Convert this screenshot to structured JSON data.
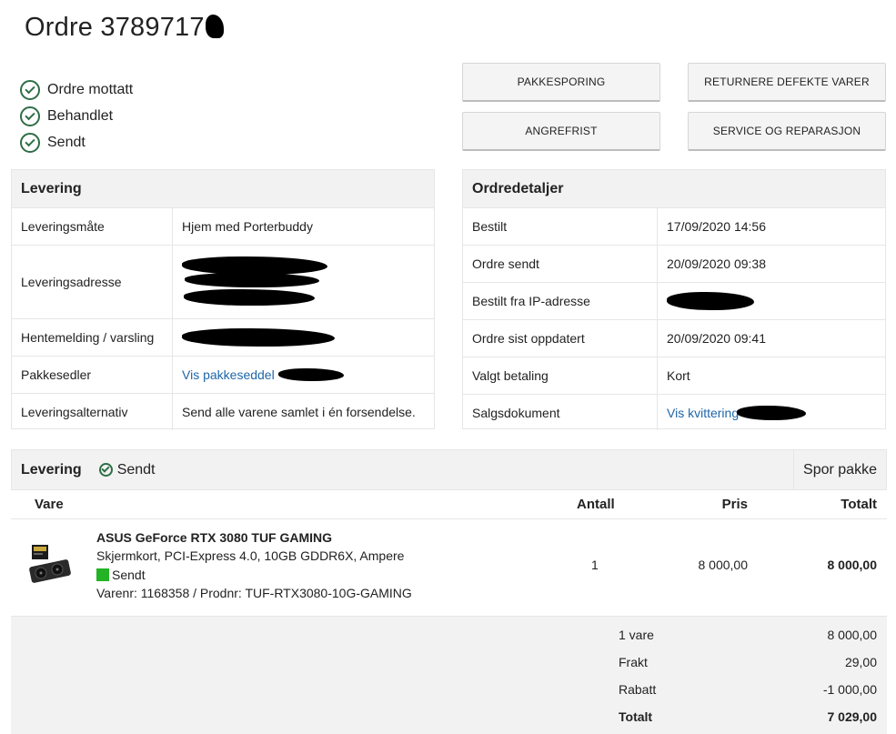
{
  "order": {
    "title": "Ordre 3789717"
  },
  "status_steps": [
    {
      "label": "Ordre mottatt"
    },
    {
      "label": "Behandlet"
    },
    {
      "label": "Sendt"
    }
  ],
  "actions": {
    "tracking": "PAKKESPORING",
    "returns": "RETURNERE DEFEKTE VARER",
    "withdrawal": "ANGREFRIST",
    "service": "SERVICE OG REPARASJON"
  },
  "delivery": {
    "heading": "Levering",
    "rows": [
      {
        "key": "Leveringsmåte",
        "value": "Hjem med Porterbuddy"
      },
      {
        "key": "Leveringsadresse",
        "value": ""
      },
      {
        "key": "Hentemelding / varsling",
        "value": ""
      },
      {
        "key": "Pakkesedler",
        "value": "Vis pakkeseddel"
      },
      {
        "key": "Leveringsalternativ",
        "value": "Send alle varene samlet i én forsendelse."
      }
    ]
  },
  "order_details": {
    "heading": "Ordredetaljer",
    "rows": [
      {
        "key": "Bestilt",
        "value": "17/09/2020 14:56"
      },
      {
        "key": "Ordre sendt",
        "value": "20/09/2020 09:38"
      },
      {
        "key": "Bestilt fra IP-adresse",
        "value": ""
      },
      {
        "key": "Ordre sist oppdatert",
        "value": "20/09/2020 09:41"
      },
      {
        "key": "Valgt betaling",
        "value": "Kort"
      },
      {
        "key": "Salgsdokument",
        "value": "Vis kvittering"
      }
    ]
  },
  "shipment": {
    "heading": "Levering",
    "status": "Sendt",
    "track_label": "Spor pakke",
    "columns": {
      "item": "Vare",
      "qty": "Antall",
      "price": "Pris",
      "total": "Totalt"
    },
    "items": [
      {
        "name": "ASUS GeForce RTX 3080 TUF GAMING",
        "description": "Skjermkort, PCI-Express 4.0, 10GB GDDR6X, Ampere",
        "status": "Sendt",
        "numbers": "Varenr: 1168358 / Prodnr: TUF-RTX3080-10G-GAMING",
        "qty": "1",
        "price": "8 000,00",
        "total": "8 000,00",
        "status_color": "#24b324"
      }
    ]
  },
  "summary": [
    {
      "label": "1 vare",
      "value": "8 000,00"
    },
    {
      "label": "Frakt",
      "value": "29,00"
    },
    {
      "label": "Rabatt",
      "value": "-1 000,00"
    },
    {
      "label": "Totalt",
      "value": "7 029,00"
    }
  ],
  "colors": {
    "accent_green": "#2e6e46",
    "link": "#1f66a8",
    "panel_bg": "#f2f2f2"
  }
}
